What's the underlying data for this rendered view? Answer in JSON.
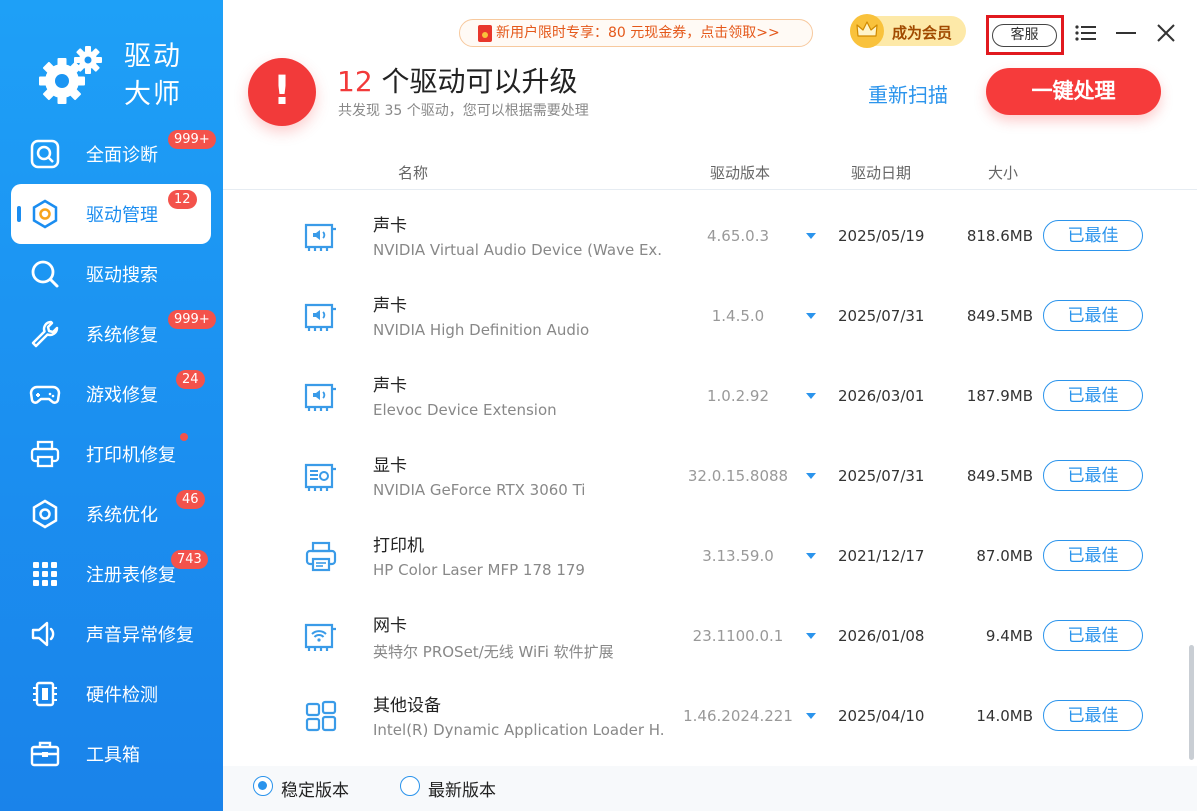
{
  "app": {
    "title_line1": "驱动",
    "title_line2": "大师"
  },
  "sidebar": {
    "items": [
      {
        "label": "全面诊断",
        "icon": "diagnose-icon",
        "badge": "999+"
      },
      {
        "label": "驱动管理",
        "icon": "driver-manage-icon",
        "badge": "12",
        "active": true
      },
      {
        "label": "驱动搜索",
        "icon": "search-icon",
        "badge": ""
      },
      {
        "label": "系统修复",
        "icon": "wrench-icon",
        "badge": "999+"
      },
      {
        "label": "游戏修复",
        "icon": "gamepad-icon",
        "badge": "24"
      },
      {
        "label": "打印机修复",
        "icon": "printer-icon",
        "badge": "",
        "dot": true
      },
      {
        "label": "系统优化",
        "icon": "optimize-icon",
        "badge": "46"
      },
      {
        "label": "注册表修复",
        "icon": "registry-grid-icon",
        "badge": "743"
      },
      {
        "label": "声音异常修复",
        "icon": "speaker-icon",
        "badge": ""
      },
      {
        "label": "硬件检测",
        "icon": "hardware-chip-icon",
        "badge": ""
      },
      {
        "label": "工具箱",
        "icon": "toolbox-icon",
        "badge": ""
      }
    ]
  },
  "header": {
    "promo": "新用户限时专享：80 元现金券，点击领取>>",
    "vip_label": "成为会员",
    "service_label": "客服"
  },
  "summary": {
    "count": "12",
    "title_rest": " 个驱动可以升级",
    "subtitle": "共发现 35 个驱动，您可以根据需要处理",
    "rescan": "重新扫描",
    "onekey": "一键处理"
  },
  "table": {
    "columns": {
      "name": "名称",
      "version": "驱动版本",
      "date": "驱动日期",
      "size": "大小"
    },
    "rows": [
      {
        "icon": "sound-card-icon",
        "category": "声卡",
        "name": "NVIDIA Virtual Audio Device (Wave Ex...",
        "version": "4.65.0.3",
        "date": "2025/05/19",
        "size": "818.6MB",
        "status": "已最佳"
      },
      {
        "icon": "sound-card-icon",
        "category": "声卡",
        "name": "NVIDIA High Definition Audio",
        "version": "1.4.5.0",
        "date": "2025/07/31",
        "size": "849.5MB",
        "status": "已最佳"
      },
      {
        "icon": "sound-card-icon",
        "category": "声卡",
        "name": "Elevoc Device Extension",
        "version": "1.0.2.92",
        "date": "2026/03/01",
        "size": "187.9MB",
        "status": "已最佳"
      },
      {
        "icon": "graphics-card-icon",
        "category": "显卡",
        "name": "NVIDIA GeForce RTX 3060 Ti",
        "version": "32.0.15.8088",
        "date": "2025/07/31",
        "size": "849.5MB",
        "status": "已最佳"
      },
      {
        "icon": "printer-icon",
        "category": "打印机",
        "name": "HP Color Laser MFP 178 179",
        "version": "3.13.59.0",
        "date": "2021/12/17",
        "size": "87.0MB",
        "status": "已最佳"
      },
      {
        "icon": "network-card-icon",
        "category": "网卡",
        "name": "英特尔 PROSet/无线 WiFi 软件扩展",
        "version": "23.1100.0.1",
        "date": "2026/01/08",
        "size": "9.4MB",
        "status": "已最佳"
      },
      {
        "icon": "other-devices-icon",
        "category": "其他设备",
        "name": "Intel(R) Dynamic Application Loader H...",
        "version": "1.46.2024.221",
        "date": "2025/04/10",
        "size": "14.0MB",
        "status": "已最佳"
      }
    ]
  },
  "footer": {
    "stable_label": "稳定版本",
    "latest_label": "最新版本",
    "selected": "stable"
  },
  "colors": {
    "sidebar": "#1b8ff0",
    "accent": "#2b94ec",
    "danger": "#f23a3a",
    "badge": "#f3524b"
  }
}
